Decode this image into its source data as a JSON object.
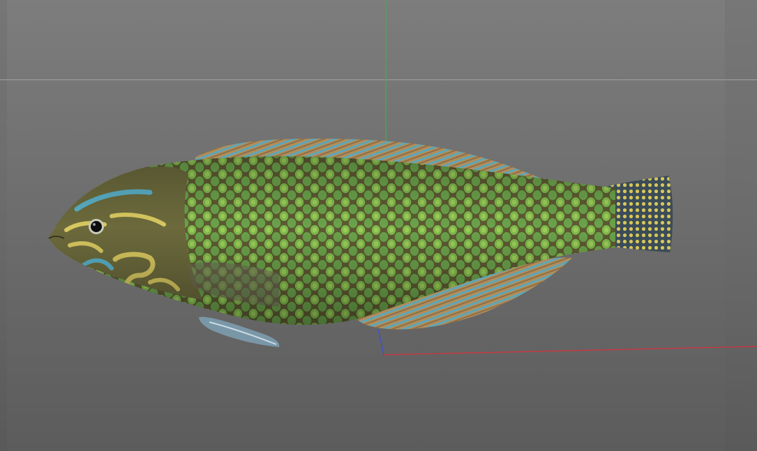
{
  "viewport": {
    "subject": "fish-3d-model",
    "background_top_color": "#7d7d7d",
    "background_bottom_color": "#5c5c5c",
    "horizon_color": "#a2a2a2"
  },
  "axes": {
    "y_axis_color": "#2fb84a",
    "x_axis_color": "#d8303a",
    "z_axis_color": "#3a4de0"
  },
  "model": {
    "body_color": "#6b6a3a",
    "spot_color": "#86c450",
    "fin_color": "#a78558",
    "accent_color": "#52a8c8",
    "head_pattern_color": "#d8c860"
  }
}
